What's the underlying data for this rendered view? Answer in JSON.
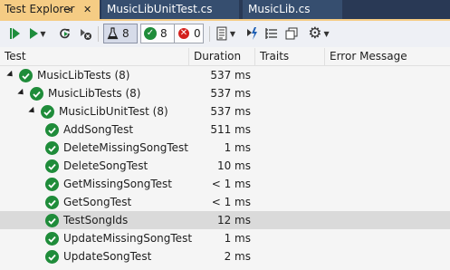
{
  "tabs": [
    {
      "label": "Test Explorer",
      "active": true
    },
    {
      "label": "MusicLibUnitTest.cs",
      "active": false
    },
    {
      "label": "MusicLib.cs",
      "active": false
    }
  ],
  "toolbar": {
    "total_count": "8",
    "passed_count": "8",
    "failed_count": "0"
  },
  "columns": {
    "test": "Test",
    "duration": "Duration",
    "traits": "Traits",
    "error": "Error Message"
  },
  "tree": [
    {
      "name": "MusicLibTests (8)",
      "duration": "537 ms",
      "level": 0,
      "expandable": true
    },
    {
      "name": "MusicLibTests (8)",
      "duration": "537 ms",
      "level": 1,
      "expandable": true
    },
    {
      "name": "MusicLibUnitTest (8)",
      "duration": "537 ms",
      "level": 2,
      "expandable": true
    },
    {
      "name": "AddSongTest",
      "duration": "511 ms",
      "level": 3,
      "expandable": false
    },
    {
      "name": "DeleteMissingSongTest",
      "duration": "1 ms",
      "level": 3,
      "expandable": false
    },
    {
      "name": "DeleteSongTest",
      "duration": "10 ms",
      "level": 3,
      "expandable": false
    },
    {
      "name": "GetMissingSongTest",
      "duration": "< 1 ms",
      "level": 3,
      "expandable": false
    },
    {
      "name": "GetSongTest",
      "duration": "< 1 ms",
      "level": 3,
      "expandable": false
    },
    {
      "name": "TestSongIds",
      "duration": "12 ms",
      "level": 3,
      "expandable": false,
      "selected": true
    },
    {
      "name": "UpdateMissingSongTest",
      "duration": "1 ms",
      "level": 3,
      "expandable": false
    },
    {
      "name": "UpdateSongTest",
      "duration": "2 ms",
      "level": 3,
      "expandable": false
    }
  ],
  "colors": {
    "pass": "#1f8c3a",
    "fail": "#d4211e",
    "active_tab": "#f5cc84",
    "tab_strip": "#293955"
  },
  "icons": [
    "pin-icon",
    "close-icon",
    "run-all-icon",
    "run-icon",
    "repeat-last-run-icon",
    "cancel-run-icon",
    "flask-icon",
    "passed-icon",
    "failed-icon",
    "playlist-icon",
    "run-on-build-icon",
    "group-by-icon",
    "copy-icon",
    "settings-icon"
  ]
}
